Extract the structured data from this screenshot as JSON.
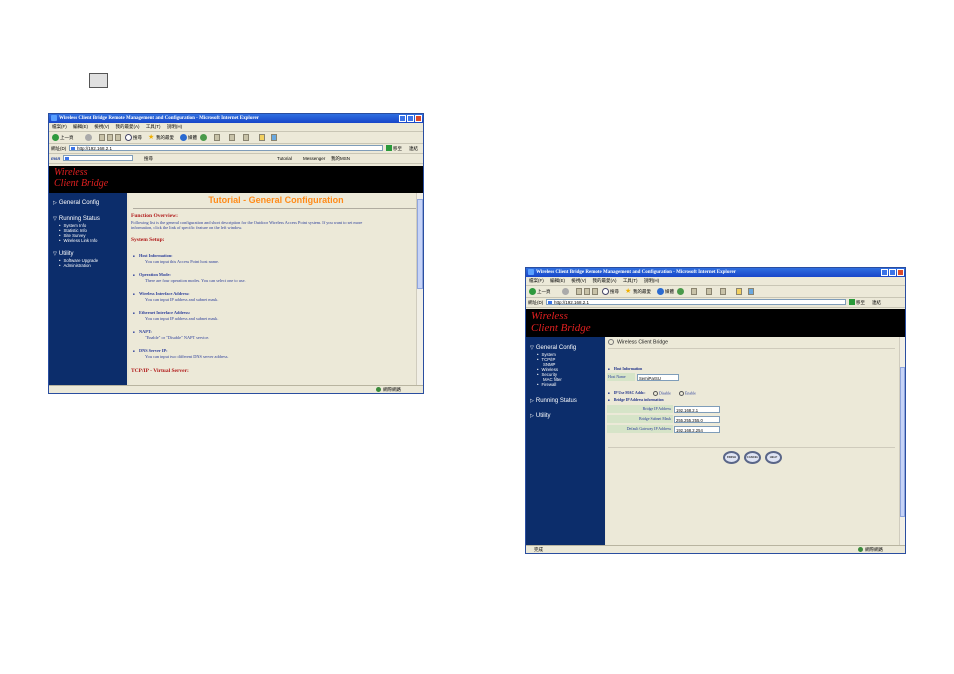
{
  "window_title": "Wireless Client Bridge Remote Management and Configuration - Microsoft Internet Explorer",
  "menu": [
    "檔案(F)",
    "編輯(E)",
    "檢視(V)",
    "我的最愛(A)",
    "工具(T)",
    "說明(H)"
  ],
  "toolbar": {
    "back": "上一頁",
    "search": "搜尋",
    "favorites": "我的最愛",
    "media": "媒體"
  },
  "address": {
    "label": "網址(D)",
    "url": "http://192.168.2.1",
    "go": "移至",
    "links": "連結"
  },
  "linkbar": {
    "search": "搜尋",
    "tutorial": "Tutorial",
    "messenger": "Messenger",
    "msn": "我的MSN"
  },
  "status": {
    "done": "完成",
    "zone": "網際網路"
  },
  "logo": {
    "line1": "Wireless",
    "line2": "Client Bridge"
  },
  "window1": {
    "nav": {
      "general": "General Config",
      "running": "Running Status",
      "running_items": [
        "System Info",
        "Statistic Info",
        "Site Survey",
        "Wireless Link Info"
      ],
      "utility": "Utility",
      "utility_items": [
        "Software Upgrade",
        "Administration"
      ]
    },
    "title": "Tutorial - General Configuration",
    "overview_heading": "Function Overview:",
    "overview_text1": "Following list is the general configuration and short description for the Outdoor Wireless Access Point system. If you want to set more",
    "overview_text2": "information, click the link of specific feature on the left window.",
    "setup_heading": "System Setup:",
    "items": [
      {
        "name": "Host Information:",
        "desc": "You can input this Access Point host name."
      },
      {
        "name": "Operation Mode:",
        "desc": "There are four operation modes. You can select one to use."
      },
      {
        "name": "Wireless Interface Address:",
        "desc": "You can input IP address and subnet mask."
      },
      {
        "name": "Ethernet Interface Address:",
        "desc": "You can input IP address and subnet mask."
      },
      {
        "name": "NAPT:",
        "desc": "\"Enable\" or \"Disable\" NAPT service."
      },
      {
        "name": "DNS Server IP:",
        "desc": "You can input two different DNS server address."
      }
    ],
    "tcpip_heading": "TCP/IP - Virtual Server:"
  },
  "window2": {
    "nav": {
      "general": "General Config",
      "general_items": [
        "System",
        "TCP/IP",
        "SNMP",
        "Wireless",
        "Security",
        "MAC filter",
        "Firewall"
      ],
      "running": "Running Status",
      "utility": "Utility"
    },
    "breadcrumb": "Wireless Client Bridge",
    "host_heading": "Host Information",
    "host_label": "Host Name",
    "host_value": "SemiParSU",
    "mac_label": "IP Use MAC Addr.:",
    "mac_opt1": "Disable",
    "mac_opt2": "Enable",
    "bridge_heading": "Bridge IP Address information",
    "rows": [
      {
        "label": "Bridge IP Address",
        "value": "192.168.2.1"
      },
      {
        "label": "Bridge Subnet Mask",
        "value": "255.255.255.0"
      },
      {
        "label": "Default Gateway IP Address",
        "value": "192.168.2.254"
      }
    ],
    "buttons": [
      "FINISH",
      "CANCEL",
      "HELP"
    ]
  }
}
